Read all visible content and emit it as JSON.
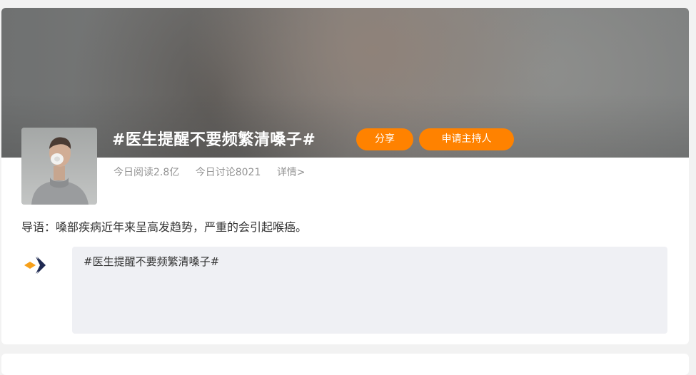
{
  "topic": {
    "title": "#医生提醒不要频繁清嗓子#",
    "share_label": "分享",
    "apply_host_label": "申请主持人",
    "reads": "今日阅读2.8亿",
    "discussions": "今日讨论8021",
    "detail_link": "详情>",
    "intro": "导语：嗓部疾病近年来呈高发趋势，严重的会引起喉癌。"
  },
  "composer": {
    "value": "#医生提醒不要频繁清嗓子#"
  },
  "colors": {
    "accent": "#ff8200",
    "composer_bg": "#eff0f4",
    "logo_orange": "#f7a01a",
    "logo_navy": "#1f2a52"
  },
  "icons": {
    "avatar": "person-with-mask-photo",
    "logo": "arrow-logo-icon"
  }
}
